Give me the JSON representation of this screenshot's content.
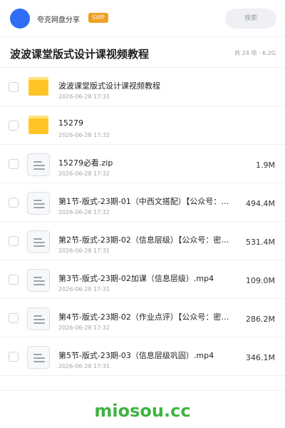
{
  "header": {
    "brand": "夸克网盘分享",
    "badge": "SVIP",
    "search_placeholder": "搜索",
    "accent_color": "#2f6df6"
  },
  "folder": {
    "title": "波波课堂版式设计课视频教程",
    "meta": "共 24 项 · 6.2G"
  },
  "items": [
    {
      "type": "folder",
      "name": "波波课堂版式设计课视频教程",
      "date": "2026-06-28 17:31",
      "size": ""
    },
    {
      "type": "folder",
      "name": "15279",
      "date": "2026-06-28 17:32",
      "size": ""
    },
    {
      "type": "file",
      "name": "15279必看.zip",
      "date": "2026-06-28 17:32",
      "size": "1.9M"
    },
    {
      "type": "file",
      "name": "第1节-版式-23期-01（中西文搭配）【公众号：…",
      "date": "2026-06-28 17:32",
      "size": "494.4M"
    },
    {
      "type": "file",
      "name": "第2节-版式-23期-02（信息层级）【公众号：密…",
      "date": "2026-06-28 17:31",
      "size": "531.4M"
    },
    {
      "type": "file",
      "name": "第3节-版式-23期-02加课（信息层级）.mp4",
      "date": "2026-06-28 17:31",
      "size": "109.0M"
    },
    {
      "type": "file",
      "name": "第4节-版式-23期-02（作业点评）【公众号：密…",
      "date": "2026-06-28 17:32",
      "size": "286.2M"
    },
    {
      "type": "file",
      "name": "第5节-版式-23期-03（信息层级巩固）.mp4",
      "date": "2026-06-28 17:31",
      "size": "346.1M"
    }
  ],
  "watermark": "miosou.cc"
}
